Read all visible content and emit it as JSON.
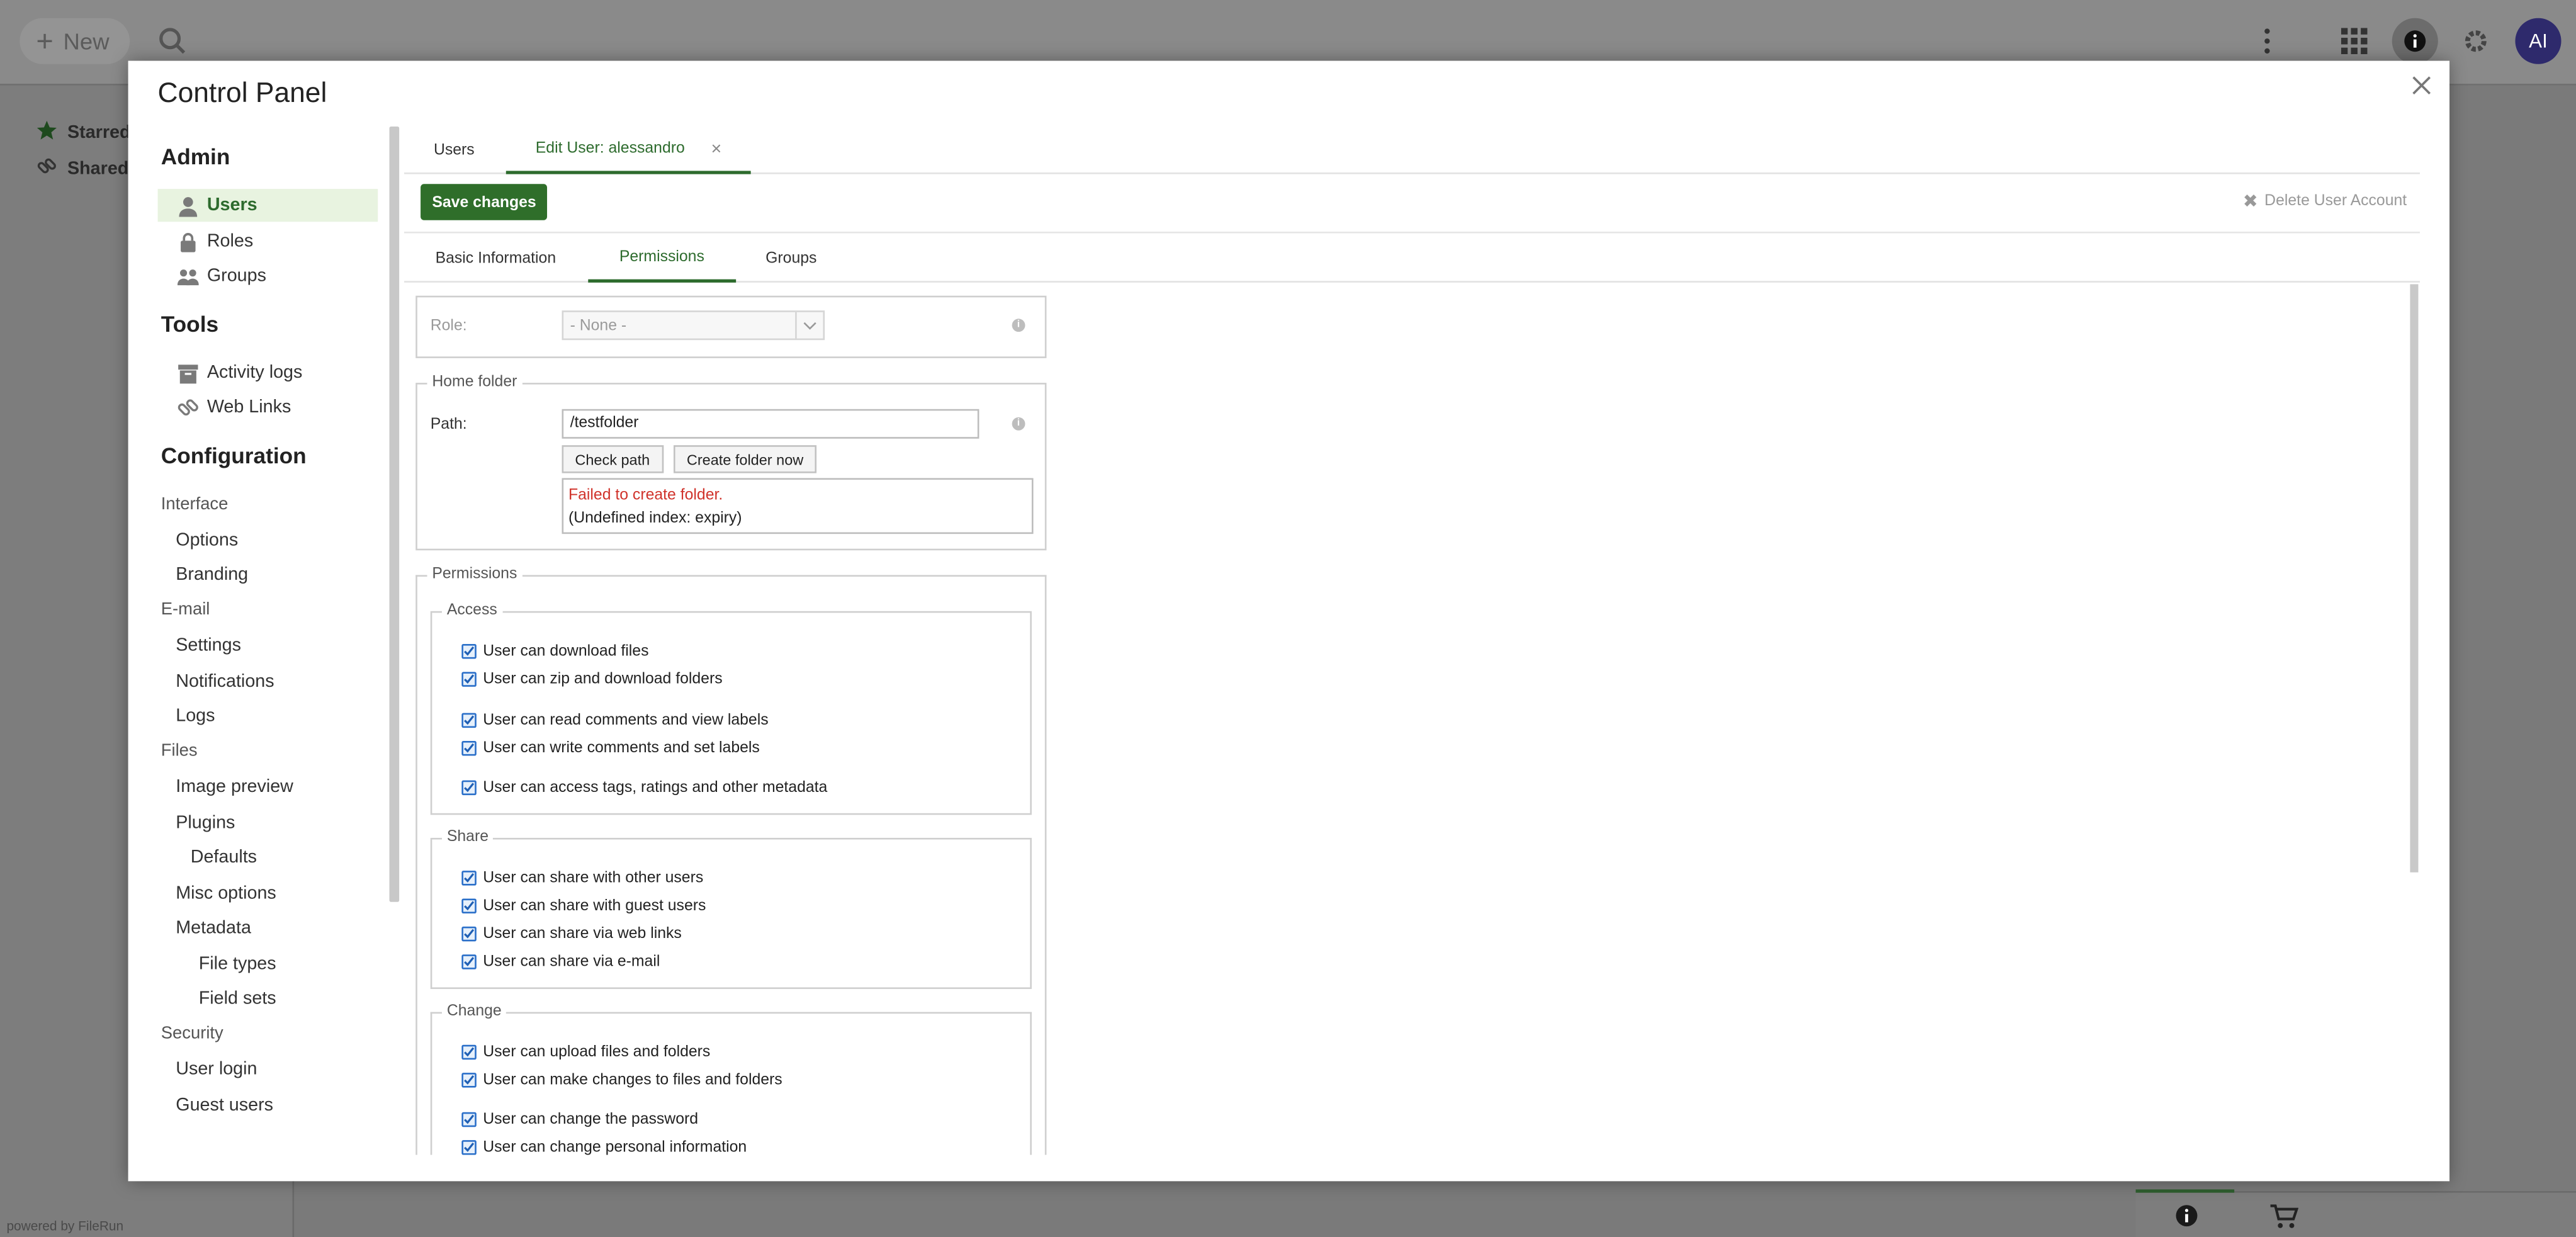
{
  "app": {
    "new_label": "New",
    "avatar_initials": "AI",
    "sidebar_items": [
      "Starred",
      "Shared l"
    ],
    "powered_by": "powered by FileRun"
  },
  "modal": {
    "title": "Control Panel",
    "nav": {
      "sections": [
        {
          "heading": "Admin",
          "items": [
            "Users",
            "Roles",
            "Groups"
          ]
        },
        {
          "heading": "Tools",
          "items": [
            "Activity logs",
            "Web Links"
          ]
        },
        {
          "heading": "Configuration"
        }
      ],
      "config": {
        "interface": "Interface",
        "options": "Options",
        "branding": "Branding",
        "email": "E-mail",
        "settings": "Settings",
        "notifications": "Notifications",
        "logs": "Logs",
        "files": "Files",
        "image_preview": "Image preview",
        "plugins": "Plugins",
        "defaults": "Defaults",
        "misc_options": "Misc options",
        "metadata": "Metadata",
        "file_types": "File types",
        "field_sets": "Field sets",
        "security": "Security",
        "user_login": "User login",
        "guest_users": "Guest users"
      }
    },
    "tabs": [
      "Users",
      "Edit User: alessandro"
    ],
    "toolbar": {
      "save": "Save changes",
      "delete": "Delete User Account"
    },
    "subtabs": [
      "Basic Information",
      "Permissions",
      "Groups"
    ],
    "form": {
      "role_label": "Role:",
      "role_value": "- None -",
      "home_folder_legend": "Home folder",
      "path_label": "Path:",
      "path_value": "/testfolder",
      "check_path": "Check path",
      "create_folder": "Create folder now",
      "error_message": "Failed to create folder.",
      "error_detail": "(Undefined index: expiry)",
      "permissions_legend": "Permissions",
      "access_legend": "Access",
      "access": [
        "User can download files",
        "User can zip and download folders",
        "User can read comments and view labels",
        "User can write comments and set labels",
        "User can access tags, ratings and other metadata"
      ],
      "share_legend": "Share",
      "share": [
        "User can share with other users",
        "User can share with guest users",
        "User can share via web links",
        "User can share via e-mail"
      ],
      "change_legend": "Change",
      "change": [
        "User can upload files and folders",
        "User can make changes to files and folders",
        "User can change the password",
        "User can change personal information"
      ]
    }
  },
  "colors": {
    "accent": "#2f6e2a",
    "error": "#d0332b",
    "avatar": "#2e2a6c"
  }
}
